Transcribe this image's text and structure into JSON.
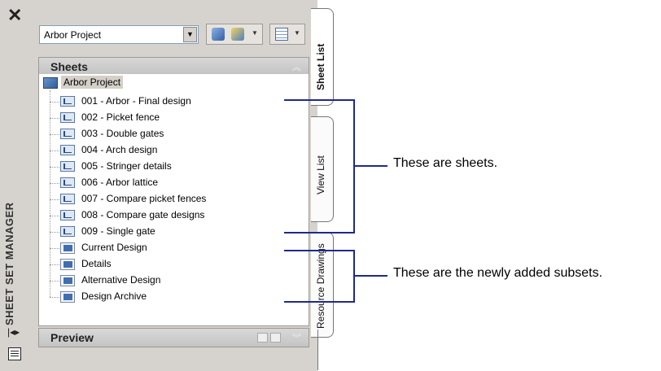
{
  "palette": {
    "title": "SHEET SET MANAGER",
    "close_icon": "close-icon",
    "sheet_set_selector": {
      "value": "Arbor Project"
    }
  },
  "sheets_panel": {
    "header": "Sheets",
    "root": "Arbor Project",
    "sheets": [
      "001 - Arbor - Final design",
      "002 - Picket fence",
      "003 - Double gates",
      "004 - Arch design",
      "005 - Stringer details",
      "006 - Arbor lattice",
      "007 - Compare picket fences",
      "008 - Compare gate designs",
      "009 - Single gate"
    ],
    "subsets": [
      "Current Design",
      "Details",
      "Alternative Design",
      "Design Archive"
    ]
  },
  "preview_panel": {
    "header": "Preview"
  },
  "tabs": {
    "sheet_list": "Sheet List",
    "view_list": "View List",
    "resource_drawings": "Resource Drawings"
  },
  "callouts": {
    "sheets": "These are sheets.",
    "subsets": "These are the newly added subsets."
  },
  "colors": {
    "callout_line": "#1f2a8a",
    "panel_bg": "#d6d3ce"
  }
}
